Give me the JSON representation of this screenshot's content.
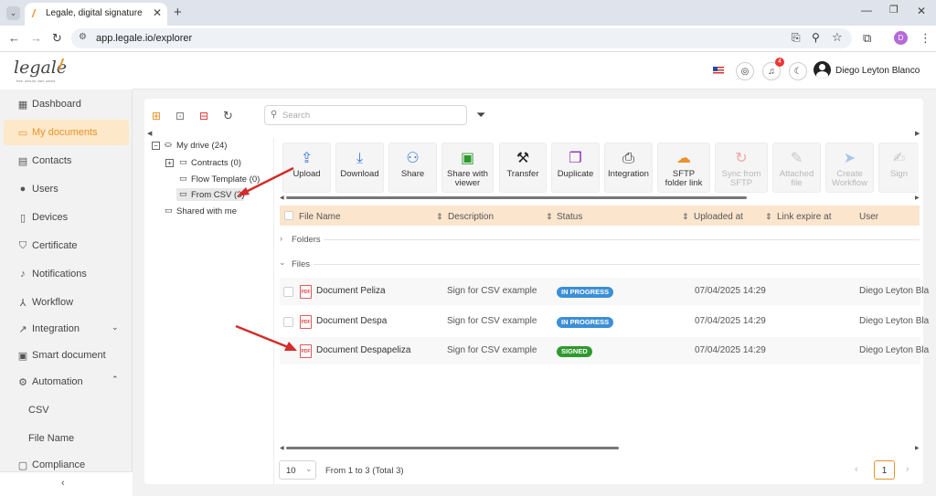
{
  "browser": {
    "tab_title": "Legale, digital signature",
    "url": "app.legale.io/explorer",
    "profile_initial": "D"
  },
  "brand": {
    "logo_text": "legale",
    "tagline": "free. secure. fast. smart",
    "accent_color": "#e8942b"
  },
  "sidebar": {
    "items": [
      {
        "label": "Dashboard",
        "icon": "dashboard-icon"
      },
      {
        "label": "My documents",
        "icon": "folder-icon"
      },
      {
        "label": "Contacts",
        "icon": "contacts-icon"
      },
      {
        "label": "Users",
        "icon": "user-icon"
      },
      {
        "label": "Devices",
        "icon": "device-icon"
      },
      {
        "label": "Certificate",
        "icon": "shield-icon"
      },
      {
        "label": "Notifications",
        "icon": "bell-icon"
      },
      {
        "label": "Workflow",
        "icon": "workflow-icon"
      },
      {
        "label": "Integration",
        "icon": "integration-icon"
      },
      {
        "label": "Smart document",
        "icon": "smart-document-icon"
      },
      {
        "label": "Automation",
        "icon": "gear-icon"
      },
      {
        "label": "CSV",
        "icon": ""
      },
      {
        "label": "File Name",
        "icon": ""
      },
      {
        "label": "Compliance",
        "icon": "compliance-icon"
      }
    ]
  },
  "header": {
    "notification_count": "4",
    "user_name": "Diego Leyton Blanco"
  },
  "explorer": {
    "search_placeholder": "Search",
    "tree": {
      "root": "My drive (24)",
      "children": [
        "Contracts (0)",
        "Flow Template (0)",
        "From CSV (3)"
      ],
      "shared": "Shared with me"
    },
    "toolbar": [
      {
        "label": "Upload",
        "icon": "upload-icon",
        "enabled": true
      },
      {
        "label": "Download",
        "icon": "download-icon",
        "enabled": true
      },
      {
        "label": "Share",
        "icon": "share-user-icon",
        "enabled": true
      },
      {
        "label": "Share with viewer",
        "icon": "share-viewer-icon",
        "enabled": true
      },
      {
        "label": "Transfer",
        "icon": "transfer-icon",
        "enabled": true
      },
      {
        "label": "Duplicate",
        "icon": "duplicate-icon",
        "enabled": true
      },
      {
        "label": "Integration",
        "icon": "printer-icon",
        "enabled": true
      },
      {
        "label": "SFTP folder link",
        "icon": "cloud-upload-icon",
        "enabled": true
      },
      {
        "label": "Sync from SFTP",
        "icon": "sync-icon",
        "enabled": false
      },
      {
        "label": "Attached file",
        "icon": "paperclip-icon",
        "enabled": false
      },
      {
        "label": "Create Workflow",
        "icon": "send-icon",
        "enabled": false
      },
      {
        "label": "Sign",
        "icon": "sign-icon",
        "enabled": false
      }
    ],
    "columns": [
      "File Name",
      "Description",
      "Status",
      "Uploaded at",
      "Link expire at",
      "User"
    ],
    "groups": {
      "folders": "Folders",
      "files": "Files"
    },
    "files": [
      {
        "name": "Document Peliza",
        "description": "Sign for CSV example",
        "status": "IN PROGRESS",
        "uploaded": "07/04/2025 14:29",
        "user": "Diego Leyton Bla"
      },
      {
        "name": "Document Despa",
        "description": "Sign for CSV example",
        "status": "IN PROGRESS",
        "uploaded": "07/04/2025 14:29",
        "user": "Diego Leyton Bla"
      },
      {
        "name": "Document Despapeliza",
        "description": "Sign for CSV example",
        "status": "SIGNED",
        "uploaded": "07/04/2025 14:29",
        "user": "Diego Leyton Bla"
      }
    ],
    "status_colors": {
      "IN PROGRESS": "#3b8fd6",
      "SIGNED": "#2e9a2e"
    },
    "pagination": {
      "page_size": "10",
      "summary": "From 1 to 3 (Total 3)",
      "current_page": "1"
    }
  }
}
